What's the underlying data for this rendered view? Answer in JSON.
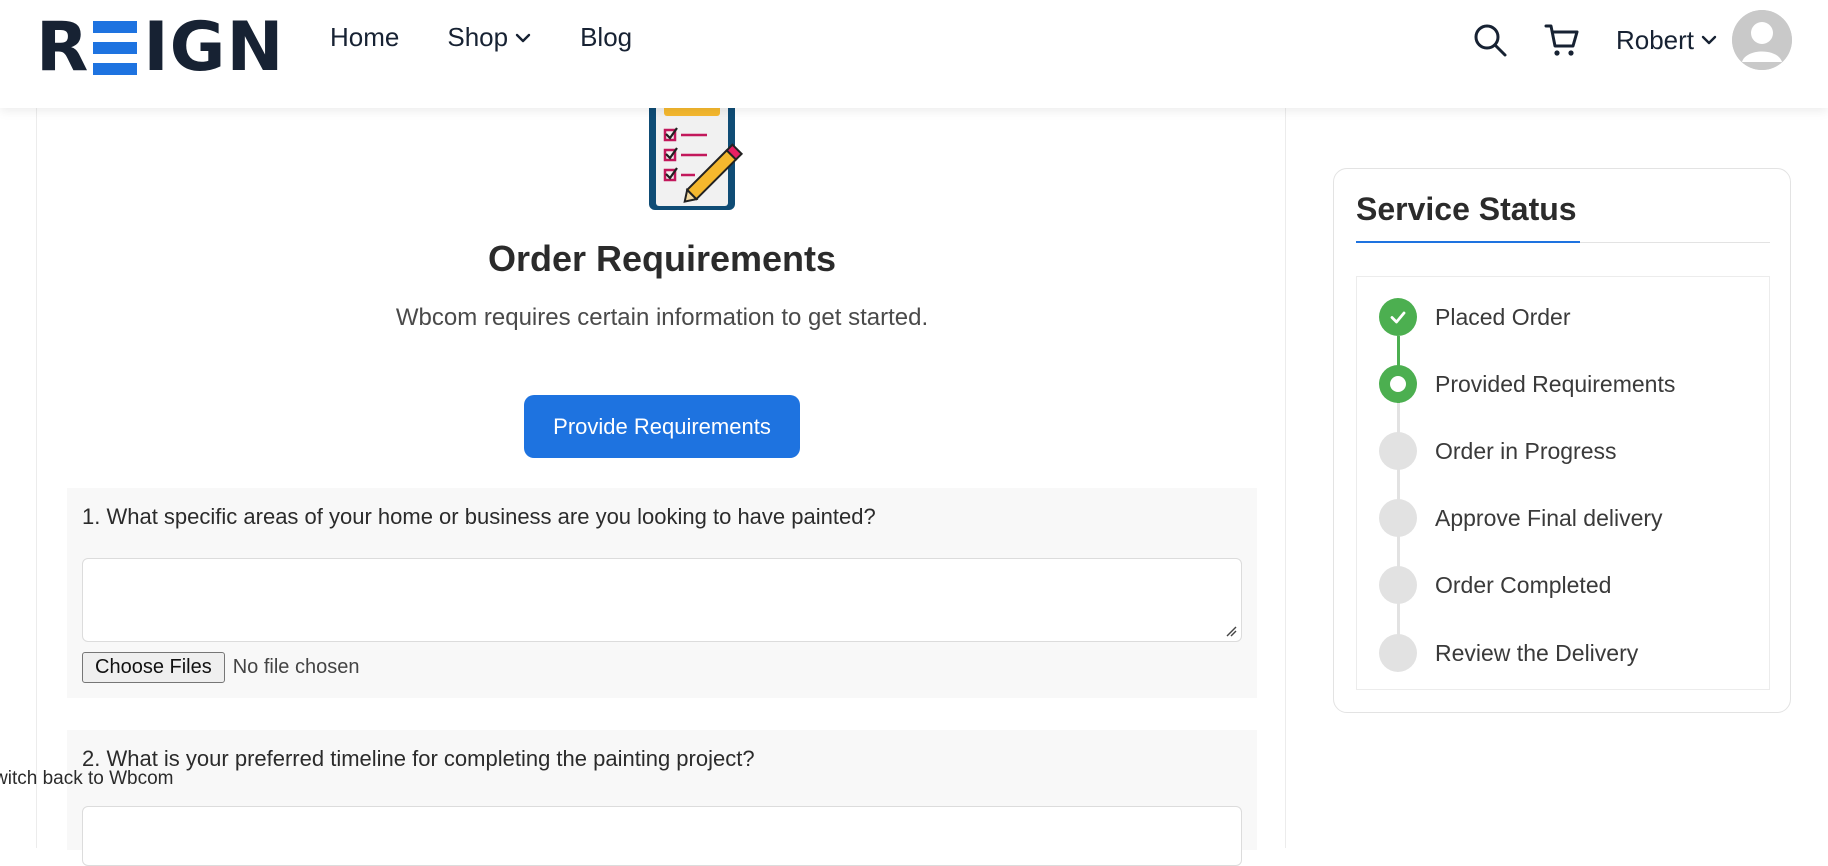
{
  "header": {
    "logo_left": "R",
    "logo_right": "IGN",
    "nav": [
      {
        "label": "Home"
      },
      {
        "label": "Shop"
      },
      {
        "label": "Blog"
      }
    ],
    "user_name": "Robert"
  },
  "main": {
    "title": "Order Requirements",
    "subtitle": "Wbcom requires certain information to get started.",
    "provide_button": "Provide Requirements",
    "questions": [
      {
        "label": "1. What specific areas of your home or business are you looking to have painted?",
        "answer": "",
        "file_button": "Choose Files",
        "file_status": "No file chosen"
      },
      {
        "label": "2. What is your preferred timeline for completing the painting project?"
      }
    ],
    "switch_back": "witch back to Wbcom"
  },
  "sidebar": {
    "title": "Service Status",
    "steps": [
      {
        "label": "Placed Order",
        "state": "done"
      },
      {
        "label": "Provided Requirements",
        "state": "current"
      },
      {
        "label": "Order in Progress",
        "state": "pending"
      },
      {
        "label": "Approve Final delivery",
        "state": "pending"
      },
      {
        "label": "Order Completed",
        "state": "pending"
      },
      {
        "label": "Review the Delivery",
        "state": "pending"
      }
    ]
  },
  "colors": {
    "accent": "#1e73e0",
    "success": "#4caf50",
    "pending": "#e2e2e2",
    "text_dark": "#172233"
  },
  "icons": [
    "search-icon",
    "cart-icon",
    "chevron-down-icon",
    "avatar-icon",
    "checklist-illustration",
    "check-icon"
  ]
}
